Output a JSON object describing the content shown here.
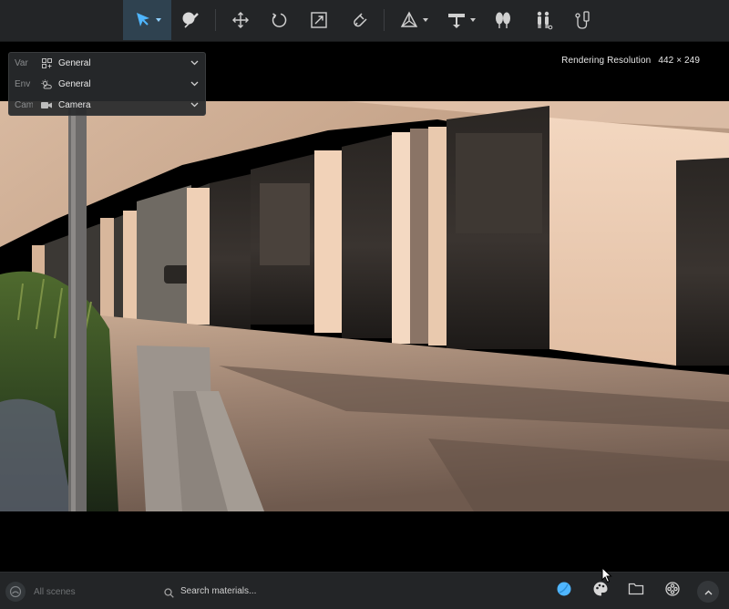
{
  "toolbar": {
    "tools": [
      {
        "name": "select-tool",
        "icon": "cursor-arrow-icon",
        "active": true,
        "dropdown": true
      },
      {
        "name": "material-picker-tool",
        "icon": "eyedropper-icon",
        "active": false,
        "dropdown": false
      },
      {
        "name": "move-tool",
        "icon": "move-arrows-icon",
        "active": false,
        "dropdown": false
      },
      {
        "name": "rotate-tool",
        "icon": "rotate-icon",
        "active": false,
        "dropdown": false
      },
      {
        "name": "scale-tool",
        "icon": "scale-icon",
        "active": false,
        "dropdown": false
      },
      {
        "name": "snap-tool",
        "icon": "magnet-icon",
        "active": false,
        "dropdown": false
      },
      {
        "name": "pivot-tool",
        "icon": "pivot-axes-icon",
        "active": false,
        "dropdown": true
      },
      {
        "name": "place-tool",
        "icon": "placement-icon",
        "active": false,
        "dropdown": true
      },
      {
        "name": "vegetation-tool",
        "icon": "trees-icon",
        "active": false,
        "dropdown": false
      },
      {
        "name": "people-tool",
        "icon": "people-icon",
        "active": false,
        "dropdown": false
      },
      {
        "name": "measure-tool",
        "icon": "measure-icon",
        "active": false,
        "dropdown": false
      }
    ],
    "accent": "#4fb6ff"
  },
  "viewport": {
    "resolution_label": "Rendering Resolution",
    "resolution_value": "442 × 249"
  },
  "overlay": {
    "rows": [
      {
        "key": "Var",
        "icon": "variations-icon",
        "value": "General"
      },
      {
        "key": "Env",
        "icon": "weather-icon",
        "value": "General"
      },
      {
        "key": "Cam",
        "icon": "camera-icon",
        "value": "Camera"
      }
    ]
  },
  "bottombar": {
    "scenes_label": "All scenes",
    "search_placeholder": "Search materials...",
    "buttons": [
      {
        "name": "materials-button",
        "icon": "sphere-icon",
        "color": "#4fb6ff"
      },
      {
        "name": "palette-button",
        "icon": "palette-icon"
      },
      {
        "name": "folder-button",
        "icon": "folder-icon"
      },
      {
        "name": "film-reel-button",
        "icon": "film-reel-icon"
      },
      {
        "name": "collapse-button",
        "icon": "chevron-up-icon"
      }
    ]
  }
}
